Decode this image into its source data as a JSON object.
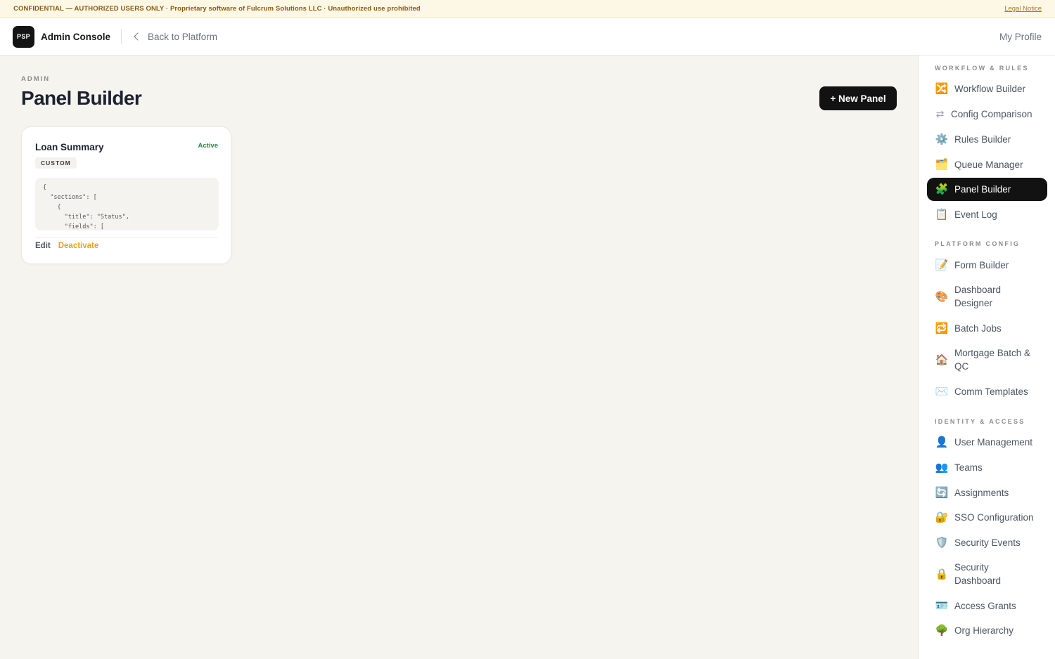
{
  "banner": {
    "message": "CONFIDENTIAL — AUTHORIZED USERS ONLY · Proprietary software of Fulcrum Solutions LLC · Unauthorized use prohibited",
    "legal_link": "Legal Notice"
  },
  "topbar": {
    "logo_text": "PSP",
    "app_title": "Admin Console",
    "back_label": "Back to Platform",
    "profile_label": "My Profile"
  },
  "page": {
    "eyebrow": "ADMIN",
    "title": "Panel Builder",
    "new_button": "+ New Panel"
  },
  "cards": [
    {
      "title": "Loan Summary",
      "status": "Active",
      "tag": "CUSTOM",
      "code": "{\n  \"sections\": [\n    {\n      \"title\": \"Status\",\n      \"fields\": [",
      "edit_label": "Edit",
      "deactivate_label": "Deactivate"
    }
  ],
  "colors": {
    "active_status": "#16924a",
    "deactivate": "#e8a21a",
    "primary_dark": "#121212",
    "banner_bg": "#fdf8e6"
  },
  "sidebar": {
    "sections": [
      {
        "label": "WORKFLOW & RULES",
        "items": [
          {
            "icon": "shuffle-icon",
            "glyph": "🔀",
            "label": "Workflow Builder",
            "active": false
          },
          {
            "icon": "swap-arrows-icon",
            "glyph": "⇄",
            "label": "Config Comparison",
            "active": false
          },
          {
            "icon": "gear-icon",
            "glyph": "⚙️",
            "label": "Rules Builder",
            "active": false
          },
          {
            "icon": "inbox-tray-icon",
            "glyph": "🗂️",
            "label": "Queue Manager",
            "active": false
          },
          {
            "icon": "puzzle-piece-icon",
            "glyph": "🧩",
            "label": "Panel Builder",
            "active": true
          },
          {
            "icon": "clipboard-icon",
            "glyph": "📋",
            "label": "Event Log",
            "active": false
          }
        ]
      },
      {
        "label": "PLATFORM CONFIG",
        "items": [
          {
            "icon": "memo-icon",
            "glyph": "📝",
            "label": "Form Builder",
            "active": false
          },
          {
            "icon": "palette-icon",
            "glyph": "🎨",
            "label": "Dashboard Designer",
            "active": false
          },
          {
            "icon": "repeat-icon",
            "glyph": "🔁",
            "label": "Batch Jobs",
            "active": false
          },
          {
            "icon": "house-icon",
            "glyph": "🏠",
            "label": "Mortgage Batch & QC",
            "active": false
          },
          {
            "icon": "envelope-icon",
            "glyph": "✉️",
            "label": "Comm Templates",
            "active": false
          }
        ]
      },
      {
        "label": "IDENTITY & ACCESS",
        "items": [
          {
            "icon": "user-icon",
            "glyph": "👤",
            "label": "User Management",
            "active": false
          },
          {
            "icon": "users-icon",
            "glyph": "👥",
            "label": "Teams",
            "active": false
          },
          {
            "icon": "refresh-icon",
            "glyph": "🔄",
            "label": "Assignments",
            "active": false
          },
          {
            "icon": "lock-key-icon",
            "glyph": "🔐",
            "label": "SSO Configuration",
            "active": false
          },
          {
            "icon": "shield-icon",
            "glyph": "🛡️",
            "label": "Security Events",
            "active": false
          },
          {
            "icon": "lock-icon",
            "glyph": "🔒",
            "label": "Security Dashboard",
            "active": false
          },
          {
            "icon": "id-card-icon",
            "glyph": "🪪",
            "label": "Access Grants",
            "active": false
          },
          {
            "icon": "tree-icon",
            "glyph": "🌳",
            "label": "Org Hierarchy",
            "active": false
          }
        ]
      }
    ]
  }
}
